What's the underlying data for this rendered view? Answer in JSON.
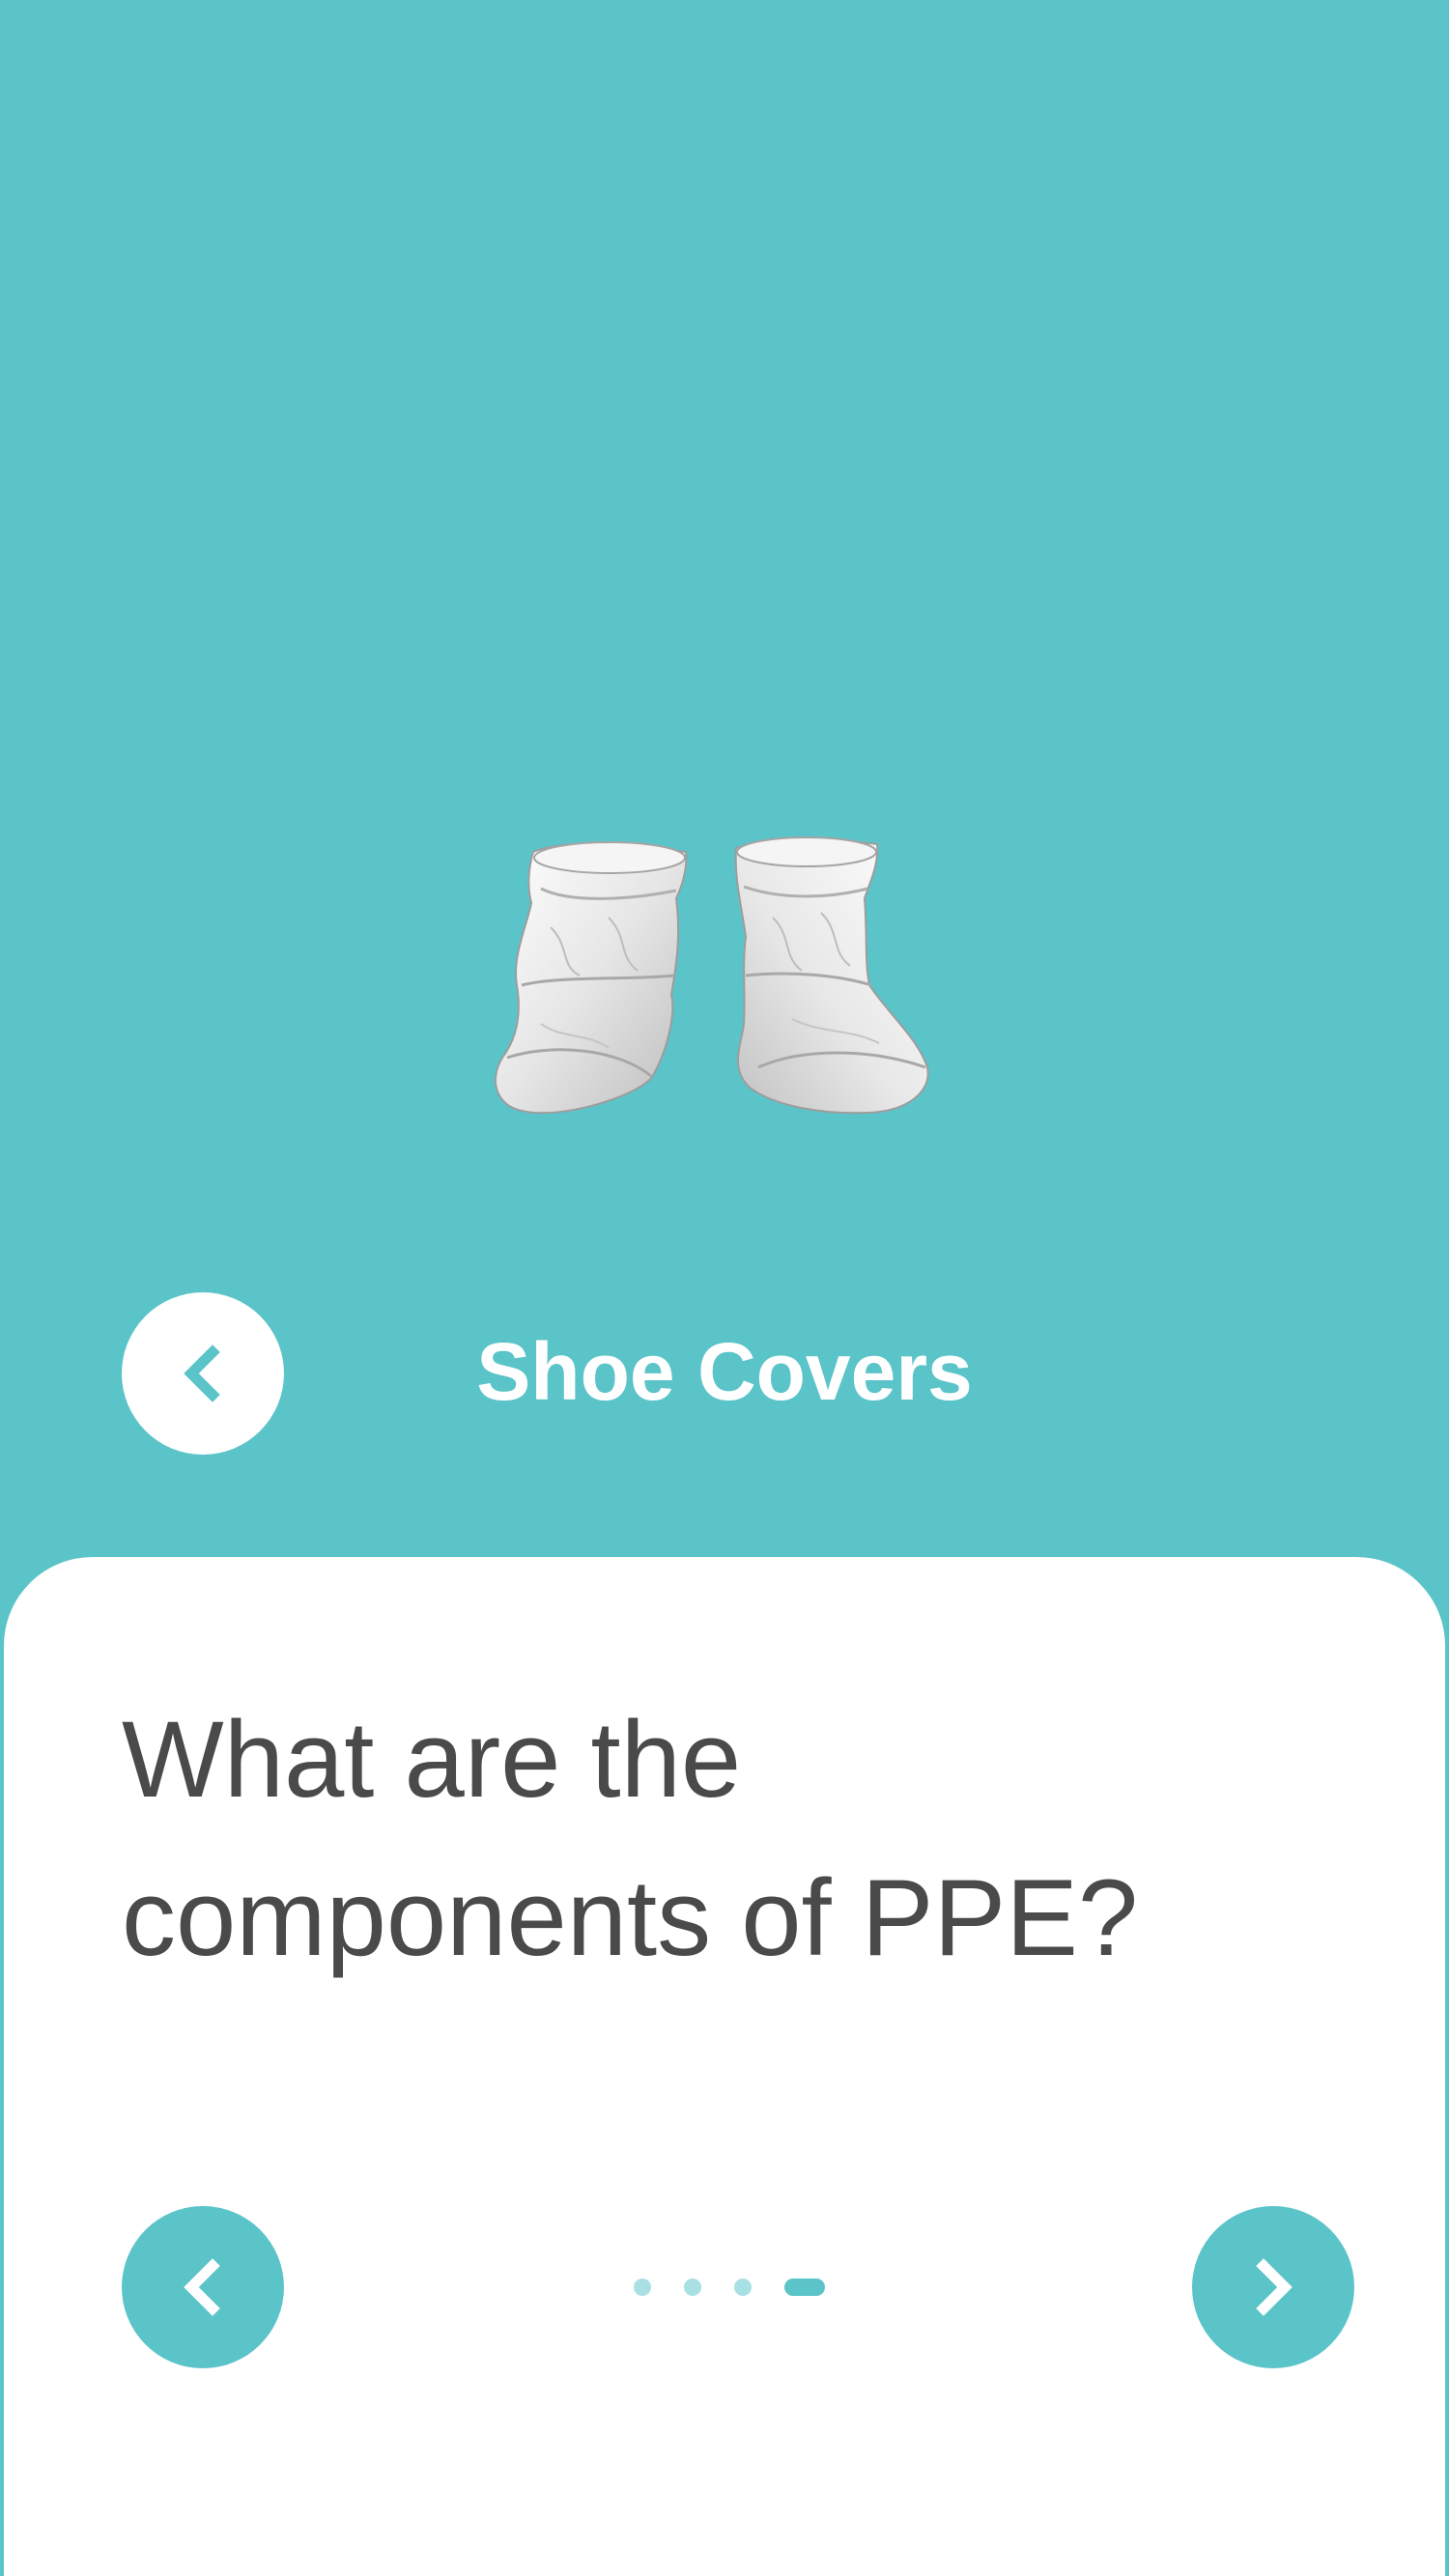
{
  "header": {
    "title": "Shoe Covers",
    "back_icon": "chevron-left-icon"
  },
  "illustration": {
    "subject": "shoe-covers"
  },
  "card": {
    "question": "What are the components of PPE?"
  },
  "pager": {
    "prev_icon": "chevron-left-icon",
    "next_icon": "chevron-right-icon",
    "total_pages": 4,
    "current_page": 4
  },
  "colors": {
    "accent": "#5bc4c9",
    "accent_light": "#a9e0e3",
    "card_bg": "#ffffff",
    "text_dark": "#4a4a4a"
  }
}
